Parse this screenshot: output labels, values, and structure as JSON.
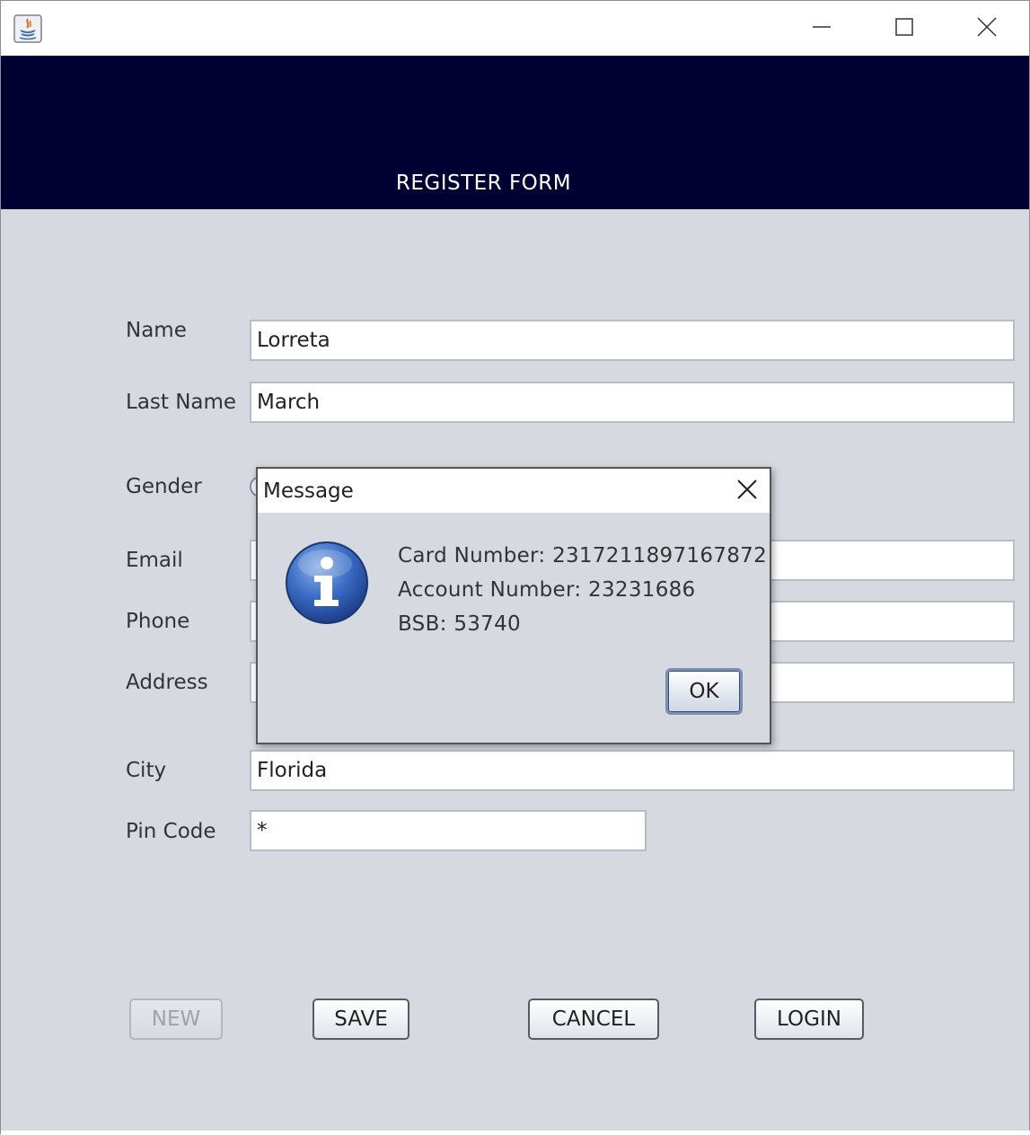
{
  "window": {
    "title": "",
    "app_icon": "java-icon",
    "controls": [
      "minimize-icon",
      "maximize-icon",
      "close-icon"
    ]
  },
  "header": {
    "title": "REGISTER FORM",
    "background": "#000033"
  },
  "form": {
    "name": {
      "label": "Name",
      "value": "Lorreta"
    },
    "last_name": {
      "label": "Last Name",
      "value": "March"
    },
    "gender": {
      "label": "Gender"
    },
    "email": {
      "label": "Email",
      "value": ""
    },
    "phone": {
      "label": "Phone",
      "value": ""
    },
    "address": {
      "label": "Address",
      "value": ""
    },
    "city": {
      "label": "City",
      "value": "Florida"
    },
    "pin_code": {
      "label": "Pin Code",
      "value": "*"
    }
  },
  "buttons": {
    "new": "NEW",
    "save": "SAVE",
    "cancel": "CANCEL",
    "login": "LOGIN"
  },
  "dialog": {
    "title": "Message",
    "icon": "info-icon",
    "lines": [
      "Card Number: 2317211897167872",
      "Account Number: 23231686",
      "BSB: 53740"
    ],
    "ok": "OK"
  }
}
